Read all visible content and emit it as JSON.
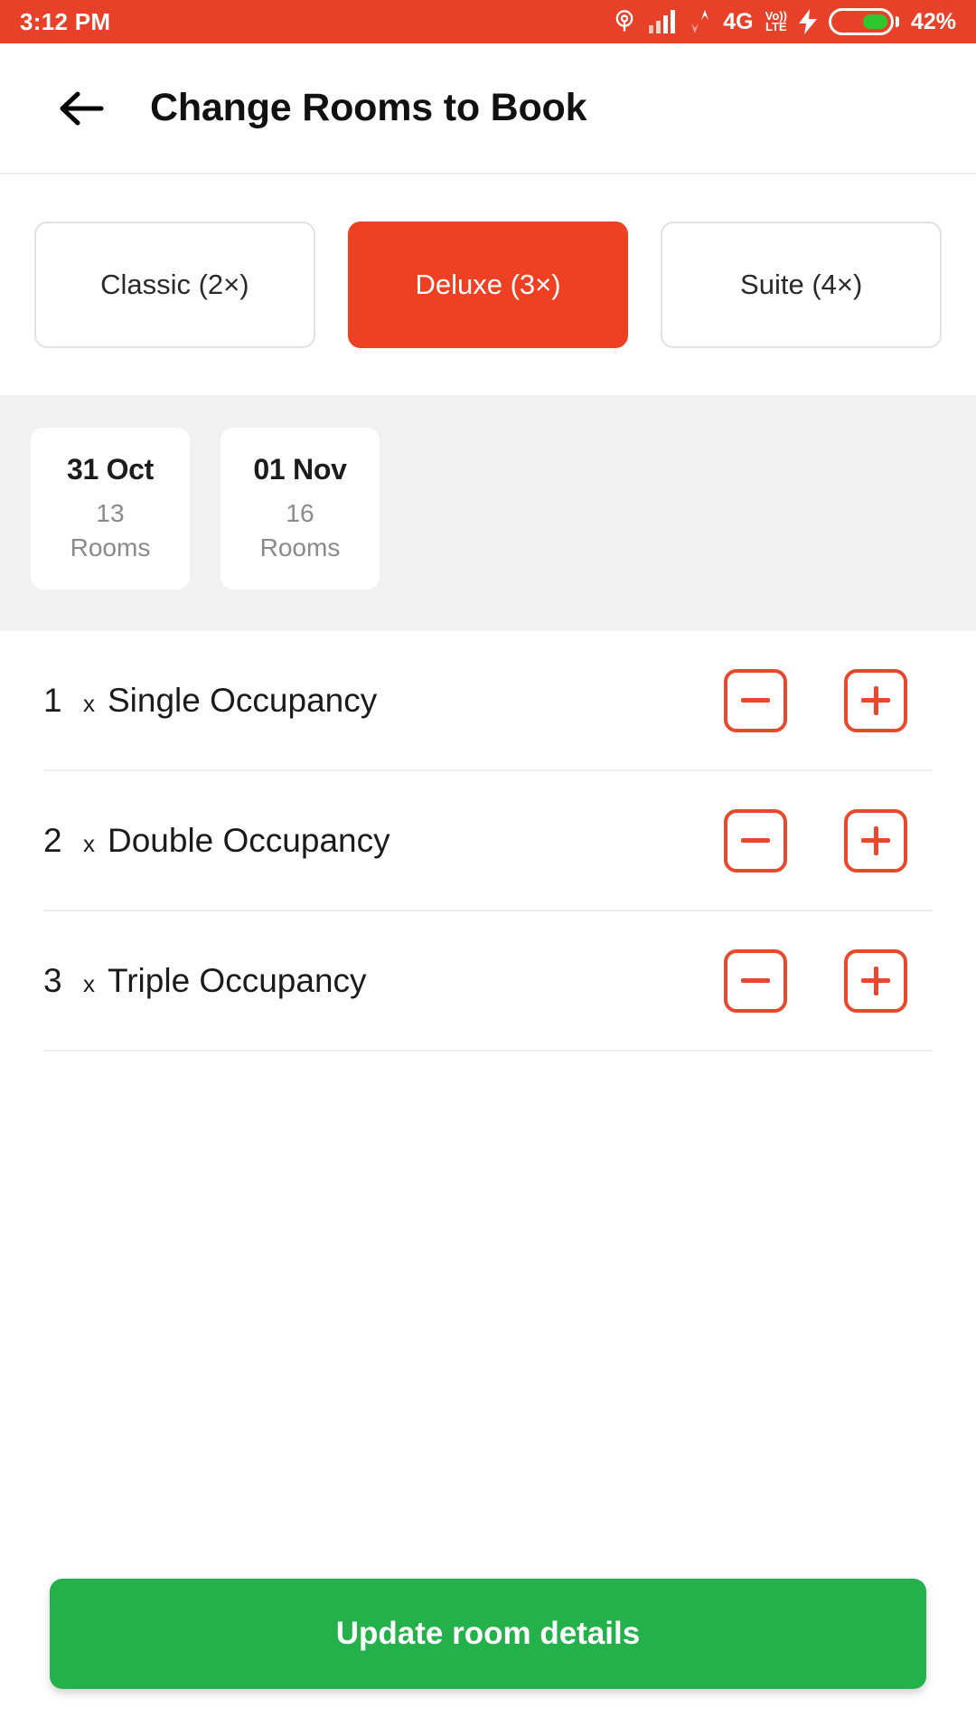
{
  "statusbar": {
    "time": "3:12 PM",
    "network_type": "4G",
    "volte_top": "Vo))",
    "volte_bottom": "LTE",
    "battery_percent": "42%",
    "icons": [
      "gps-icon",
      "signal-bars-icon",
      "data-transfer-icon",
      "volte-icon",
      "charging-bolt-icon",
      "battery-icon"
    ],
    "bg_color": "#E8412A"
  },
  "header": {
    "title": "Change Rooms to Book",
    "back_icon": "arrow-left-icon"
  },
  "room_types": [
    {
      "label": "Classic (2×)",
      "selected": false
    },
    {
      "label": "Deluxe (3×)",
      "selected": true
    },
    {
      "label": "Suite (4×)",
      "selected": false
    }
  ],
  "dates": [
    {
      "date": "31 Oct",
      "count": "13",
      "unit": "Rooms"
    },
    {
      "date": "01 Nov",
      "count": "16",
      "unit": "Rooms"
    }
  ],
  "occupancy_rows": [
    {
      "qty": "1",
      "x": "x",
      "name": "Single Occupancy",
      "minus": "−",
      "plus": "+"
    },
    {
      "qty": "2",
      "x": "x",
      "name": "Double Occupancy",
      "minus": "−",
      "plus": "+"
    },
    {
      "qty": "3",
      "x": "x",
      "name": "Triple Occupancy",
      "minus": "−",
      "plus": "+"
    }
  ],
  "cta": {
    "label": "Update room details",
    "color": "#24B14B"
  },
  "colors": {
    "accent_red": "#EE4023",
    "status_red": "#E8412A",
    "green": "#24B14B",
    "grey_strip": "#F2F2F2"
  }
}
